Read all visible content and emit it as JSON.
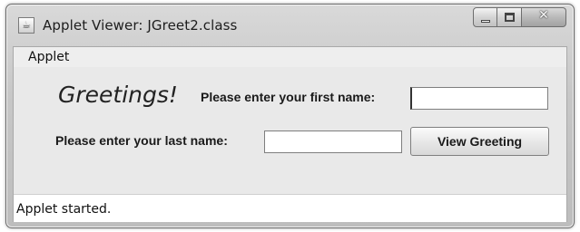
{
  "window": {
    "title": "Applet Viewer: JGreet2.class",
    "icon": "java-cup-icon",
    "controls": [
      "minimize-icon",
      "maximize-icon",
      "close-icon"
    ]
  },
  "menubar": {
    "items": [
      {
        "label": "Applet"
      }
    ]
  },
  "form": {
    "greeting": "Greetings!",
    "first_name_label": "Please enter your first name:",
    "first_name_value": "",
    "last_name_label": "Please enter your last name:",
    "last_name_value": "",
    "view_button_label": "View Greeting"
  },
  "status": {
    "text": "Applet started."
  }
}
